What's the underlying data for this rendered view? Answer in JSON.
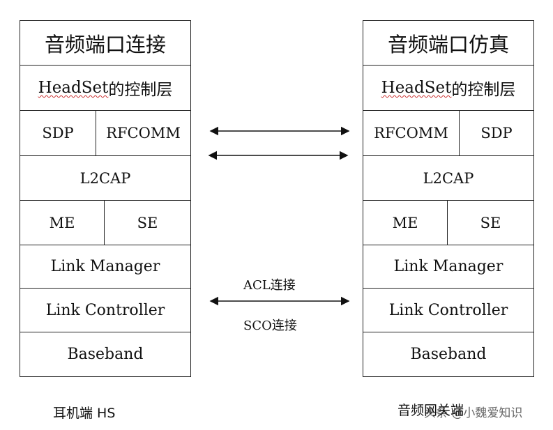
{
  "left_stack": {
    "title": "音频端口连接",
    "control": {
      "latin": "HeadSet",
      "cn": "的控制层"
    },
    "row3": [
      "SDP",
      "RFCOMM"
    ],
    "row4": "L2CAP",
    "row5": [
      "ME",
      "SE"
    ],
    "row6": "Link Manager",
    "row7": "Link Controller",
    "row8": "Baseband",
    "caption": "耳机端 HS"
  },
  "right_stack": {
    "title": "音频端口仿真",
    "control": {
      "latin": "HeadSet",
      "cn": "的控制层"
    },
    "row3": [
      "RFCOMM",
      "SDP"
    ],
    "row4": "L2CAP",
    "row5": [
      "ME",
      "SE"
    ],
    "row6": "Link Manager",
    "row7": "Link Controller",
    "row8": "Baseband",
    "caption": "音频网关端"
  },
  "links": {
    "acl": "ACL连接",
    "sco": "SCO连接"
  },
  "watermark": "头条 @小魏爱知识"
}
